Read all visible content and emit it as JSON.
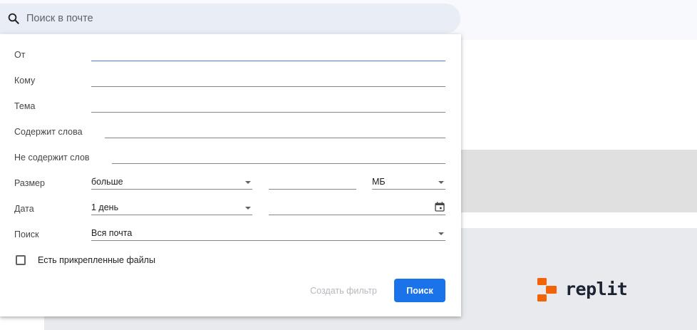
{
  "search": {
    "placeholder": "Поиск в почте",
    "icon": "search-icon"
  },
  "form": {
    "from_label": "От",
    "to_label": "Кому",
    "subject_label": "Тема",
    "has_words_label": "Содержит слова",
    "not_words_label": "Не содержит слов",
    "size_label": "Размер",
    "size_operator": "больше",
    "size_unit": "МБ",
    "date_label": "Дата",
    "date_range": "1 день",
    "search_in_label": "Поиск",
    "search_in_value": "Вся почта",
    "attachment_label": "Есть прикрепленные файлы",
    "attachment_checked": false
  },
  "actions": {
    "create_filter": "Создать фильтр",
    "search": "Поиск"
  },
  "background": {
    "brand_text": "replit",
    "brand_color": "#f26207"
  },
  "colors": {
    "primary_button": "#1a73e8",
    "focus_underline": "#4c7bd9"
  }
}
